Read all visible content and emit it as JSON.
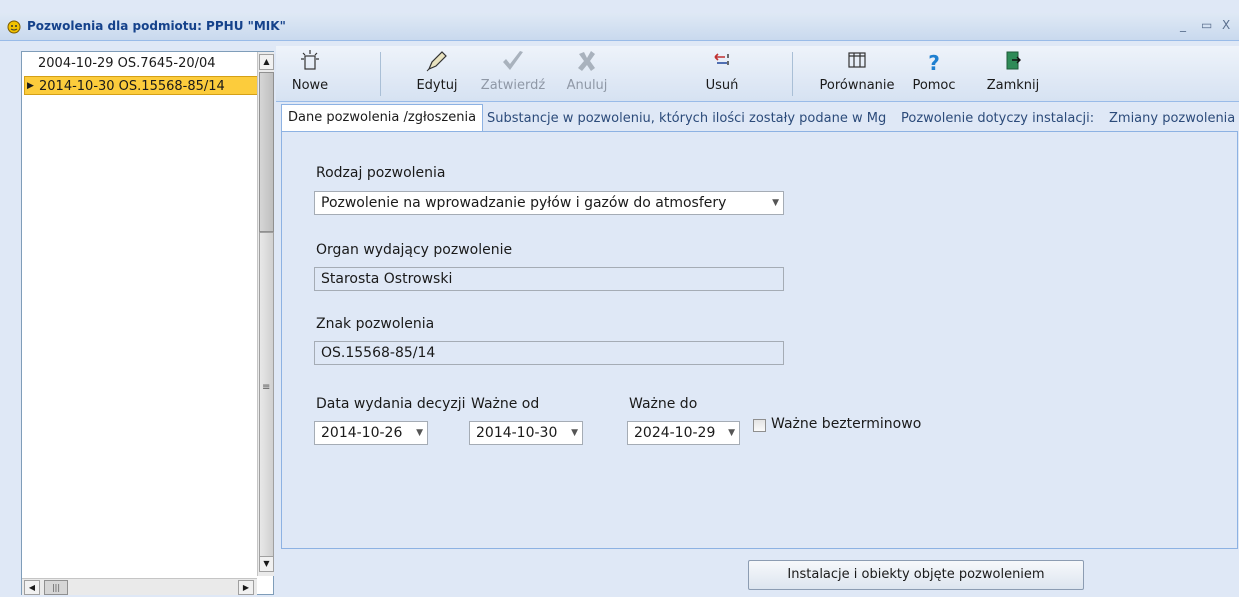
{
  "window": {
    "title": "Pozwolenia dla podmiotu: PPHU \"MIK\"",
    "controls": {
      "minimize": "_",
      "maximize": "▭",
      "close": "X"
    }
  },
  "list": {
    "items": [
      {
        "text": "2004-10-29  OS.7645-20/04",
        "selected": false
      },
      {
        "text": "2014-10-30  OS.15568-85/14",
        "selected": true
      }
    ]
  },
  "toolbar": {
    "nowe": "Nowe",
    "edytuj": "Edytuj",
    "zatwierdz": "Zatwierdź",
    "anuluj": "Anuluj",
    "usun": "Usuń",
    "porownanie": "Porównanie",
    "pomoc": "Pomoc",
    "zamknij": "Zamknij"
  },
  "tabs": [
    {
      "label": "Dane pozwolenia /zgłoszenia",
      "active": true
    },
    {
      "label": "Substancje w pozwoleniu, których ilości zostały podane w Mg",
      "active": false
    },
    {
      "label": "Pozwolenie dotyczy instalacji:",
      "active": false
    },
    {
      "label": "Zmiany pozwolenia",
      "active": false
    }
  ],
  "form": {
    "rodzaj_label": "Rodzaj pozwolenia",
    "rodzaj_value": "Pozwolenie na wprowadzanie pyłów i gazów do atmosfery",
    "organ_label": "Organ wydający pozwolenie",
    "organ_value": "Starosta Ostrowski",
    "znak_label": "Znak pozwolenia",
    "znak_value": "OS.15568-85/14",
    "data_wydania_label": "Data wydania decyzji",
    "data_wydania_value": "2014-10-26",
    "wazne_od_label": "Ważne od",
    "wazne_od_value": "2014-10-30",
    "wazne_do_label": "Ważne do",
    "wazne_do_value": "2024-10-29",
    "bezterminowo_label": "Ważne bezterminowo",
    "bezterminowo_checked": false
  },
  "bottom_button": "Instalacje i obiekty objęte  pozwoleniem",
  "colors": {
    "accent": "#15428b",
    "selection": "#fccc3c",
    "panel": "#dfe8f6"
  }
}
